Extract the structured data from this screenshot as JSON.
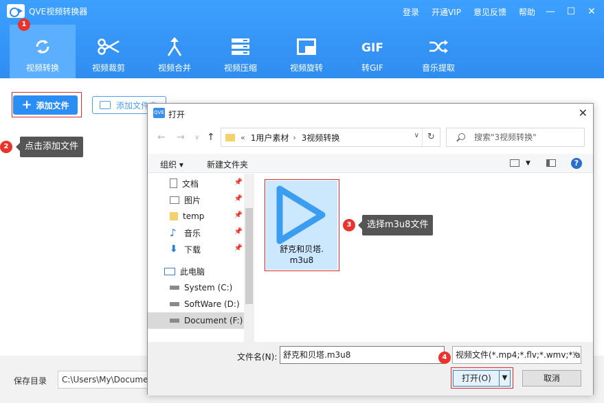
{
  "app": {
    "title": "QVE视频转换器",
    "links": [
      "登录",
      "开通VIP",
      "意见反馈",
      "帮助"
    ],
    "window_controls": [
      "—",
      "☐",
      "✕"
    ]
  },
  "toolbar": {
    "items": [
      {
        "label": "视频转换",
        "icon": "convert-icon"
      },
      {
        "label": "视频裁剪",
        "icon": "scissors-icon"
      },
      {
        "label": "视频合并",
        "icon": "merge-icon"
      },
      {
        "label": "视频压缩",
        "icon": "compress-icon"
      },
      {
        "label": "视频旋转",
        "icon": "rotate-icon"
      },
      {
        "label": "转GIF",
        "icon": "gif-icon"
      },
      {
        "label": "音乐提取",
        "icon": "shuffle-icon"
      }
    ],
    "active_index": 0
  },
  "main": {
    "add_file": "添加文件",
    "add_folder": "添加文件夹",
    "save_dir_label": "保存目录",
    "save_dir_value": "C:\\Users\\My\\Documents"
  },
  "steps": {
    "badge1": "1",
    "badge2": "2",
    "tip2": "点击添加文件",
    "badge3": "3",
    "tip3": "选择m3u8文件",
    "badge4": "4"
  },
  "dialog": {
    "title": "打开",
    "logo_text": "QVE",
    "close": "✕",
    "address": {
      "prefix": "«",
      "segments": [
        "1用户素材",
        "3视频转换"
      ],
      "refresh": "↻"
    },
    "search_placeholder": "搜索\"3视频转换\"",
    "commands": {
      "organize": "组织 ▾",
      "new_folder": "新建文件夹",
      "help": "?"
    },
    "nav_items": [
      {
        "label": "文档",
        "pinned": true
      },
      {
        "label": "图片",
        "pinned": true
      },
      {
        "label": "temp",
        "pinned": true
      },
      {
        "label": "音乐",
        "pinned": true
      },
      {
        "label": "下载",
        "pinned": true
      },
      {
        "label": "此电脑",
        "pinned": false
      },
      {
        "label": "System (C:)",
        "pinned": false
      },
      {
        "label": "SoftWare (D:)",
        "pinned": false
      },
      {
        "label": "Document (F:)",
        "pinned": false
      }
    ],
    "file": {
      "name": "舒克和贝塔.m3u8",
      "name_line1": "舒克和贝塔.",
      "name_line2": "m3u8"
    },
    "footer": {
      "filename_label": "文件名(N):",
      "filename_value": "舒克和贝塔.m3u8",
      "filter_value": "视频文件(*.mp4;*.flv;*.wmv;*.a",
      "open_label": "打开(O)",
      "cancel_label": "取消"
    }
  },
  "colors": {
    "accent": "#2f8df0",
    "step_red": "#e8342c",
    "tile_selected": "#cce8ff",
    "play_blue": "#3a9df0"
  }
}
